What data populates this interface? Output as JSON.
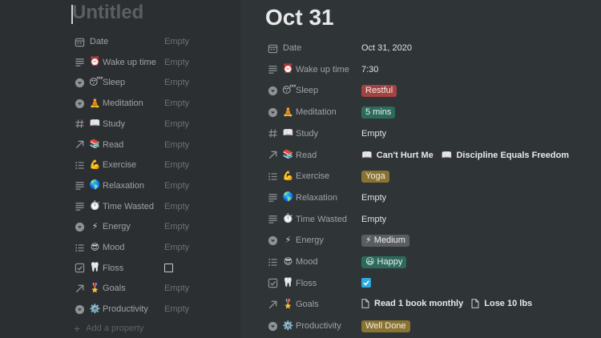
{
  "left": {
    "title": "Untitled",
    "add_property": "Add a property",
    "properties": [
      {
        "icon": "calendar-icon",
        "emoji": "",
        "label": "Date",
        "value": "Empty"
      },
      {
        "icon": "text-icon",
        "emoji": "⏰",
        "label": "Wake up time",
        "value": "Empty"
      },
      {
        "icon": "select-icon",
        "emoji": "😴",
        "label": "Sleep",
        "value": "Empty"
      },
      {
        "icon": "select-icon",
        "emoji": "🧘",
        "label": "Meditation",
        "value": "Empty"
      },
      {
        "icon": "number-icon",
        "emoji": "📖",
        "label": "Study",
        "value": "Empty"
      },
      {
        "icon": "relation-icon",
        "emoji": "📚",
        "label": "Read",
        "value": "Empty"
      },
      {
        "icon": "multiselect-icon",
        "emoji": "💪",
        "label": "Exercise",
        "value": "Empty"
      },
      {
        "icon": "text-icon",
        "emoji": "🌎",
        "label": "Relaxation",
        "value": "Empty"
      },
      {
        "icon": "text-icon",
        "emoji": "⏱️",
        "label": "Time Wasted",
        "value": "Empty"
      },
      {
        "icon": "select-icon",
        "emoji": "⚡",
        "label": "Energy",
        "value": "Empty"
      },
      {
        "icon": "multiselect-icon",
        "emoji": "😎",
        "label": "Mood",
        "value": "Empty"
      },
      {
        "icon": "checkbox-icon",
        "emoji": "🦷",
        "label": "Floss",
        "value": "",
        "checkbox": true
      },
      {
        "icon": "relation-icon",
        "emoji": "🎖️",
        "label": "Goals",
        "value": "Empty"
      },
      {
        "icon": "select-icon",
        "emoji": "⚙️",
        "label": "Productivity",
        "value": "Empty"
      }
    ]
  },
  "right": {
    "title": "Oct 31",
    "properties": [
      {
        "icon": "calendar-icon",
        "emoji": "",
        "label": "Date",
        "type": "text",
        "value": "Oct 31, 2020"
      },
      {
        "icon": "text-icon",
        "emoji": "⏰",
        "label": "Wake up time",
        "type": "text",
        "value": "7:30"
      },
      {
        "icon": "select-icon",
        "emoji": "😴",
        "label": "Sleep",
        "type": "tag",
        "value": "Restful",
        "color": "#a4423f"
      },
      {
        "icon": "select-icon",
        "emoji": "🧘",
        "label": "Meditation",
        "type": "tag",
        "value": "5 mins",
        "color": "#2c6b5c"
      },
      {
        "icon": "number-icon",
        "emoji": "📖",
        "label": "Study",
        "type": "empty",
        "value": "Empty"
      },
      {
        "icon": "relation-icon",
        "emoji": "📚",
        "label": "Read",
        "type": "relation",
        "items": [
          {
            "icon": "📖",
            "text": "Can't Hurt Me"
          },
          {
            "icon": "📖",
            "text": "Discipline Equals Freedom"
          }
        ]
      },
      {
        "icon": "multiselect-icon",
        "emoji": "💪",
        "label": "Exercise",
        "type": "tag",
        "value": "Yoga",
        "color": "#8a7330"
      },
      {
        "icon": "text-icon",
        "emoji": "🌎",
        "label": "Relaxation",
        "type": "empty",
        "value": "Empty"
      },
      {
        "icon": "text-icon",
        "emoji": "⏱️",
        "label": "Time Wasted",
        "type": "empty",
        "value": "Empty"
      },
      {
        "icon": "select-icon",
        "emoji": "⚡",
        "label": "Energy",
        "type": "tag",
        "value": "⚡ Medium",
        "color": "#5a5e61"
      },
      {
        "icon": "multiselect-icon",
        "emoji": "😎",
        "label": "Mood",
        "type": "tag",
        "value": "😃 Happy",
        "color": "#2c6b5c"
      },
      {
        "icon": "checkbox-icon",
        "emoji": "🦷",
        "label": "Floss",
        "type": "checkbox",
        "value": "",
        "checked": true
      },
      {
        "icon": "relation-icon",
        "emoji": "🎖️",
        "label": "Goals",
        "type": "files",
        "items": [
          {
            "text": "Read 1 book monthly"
          },
          {
            "text": "Lose 10 lbs"
          }
        ]
      },
      {
        "icon": "select-icon",
        "emoji": "⚙️",
        "label": "Productivity",
        "type": "tag",
        "value": "Well Done",
        "color": "#8a7330"
      }
    ]
  }
}
